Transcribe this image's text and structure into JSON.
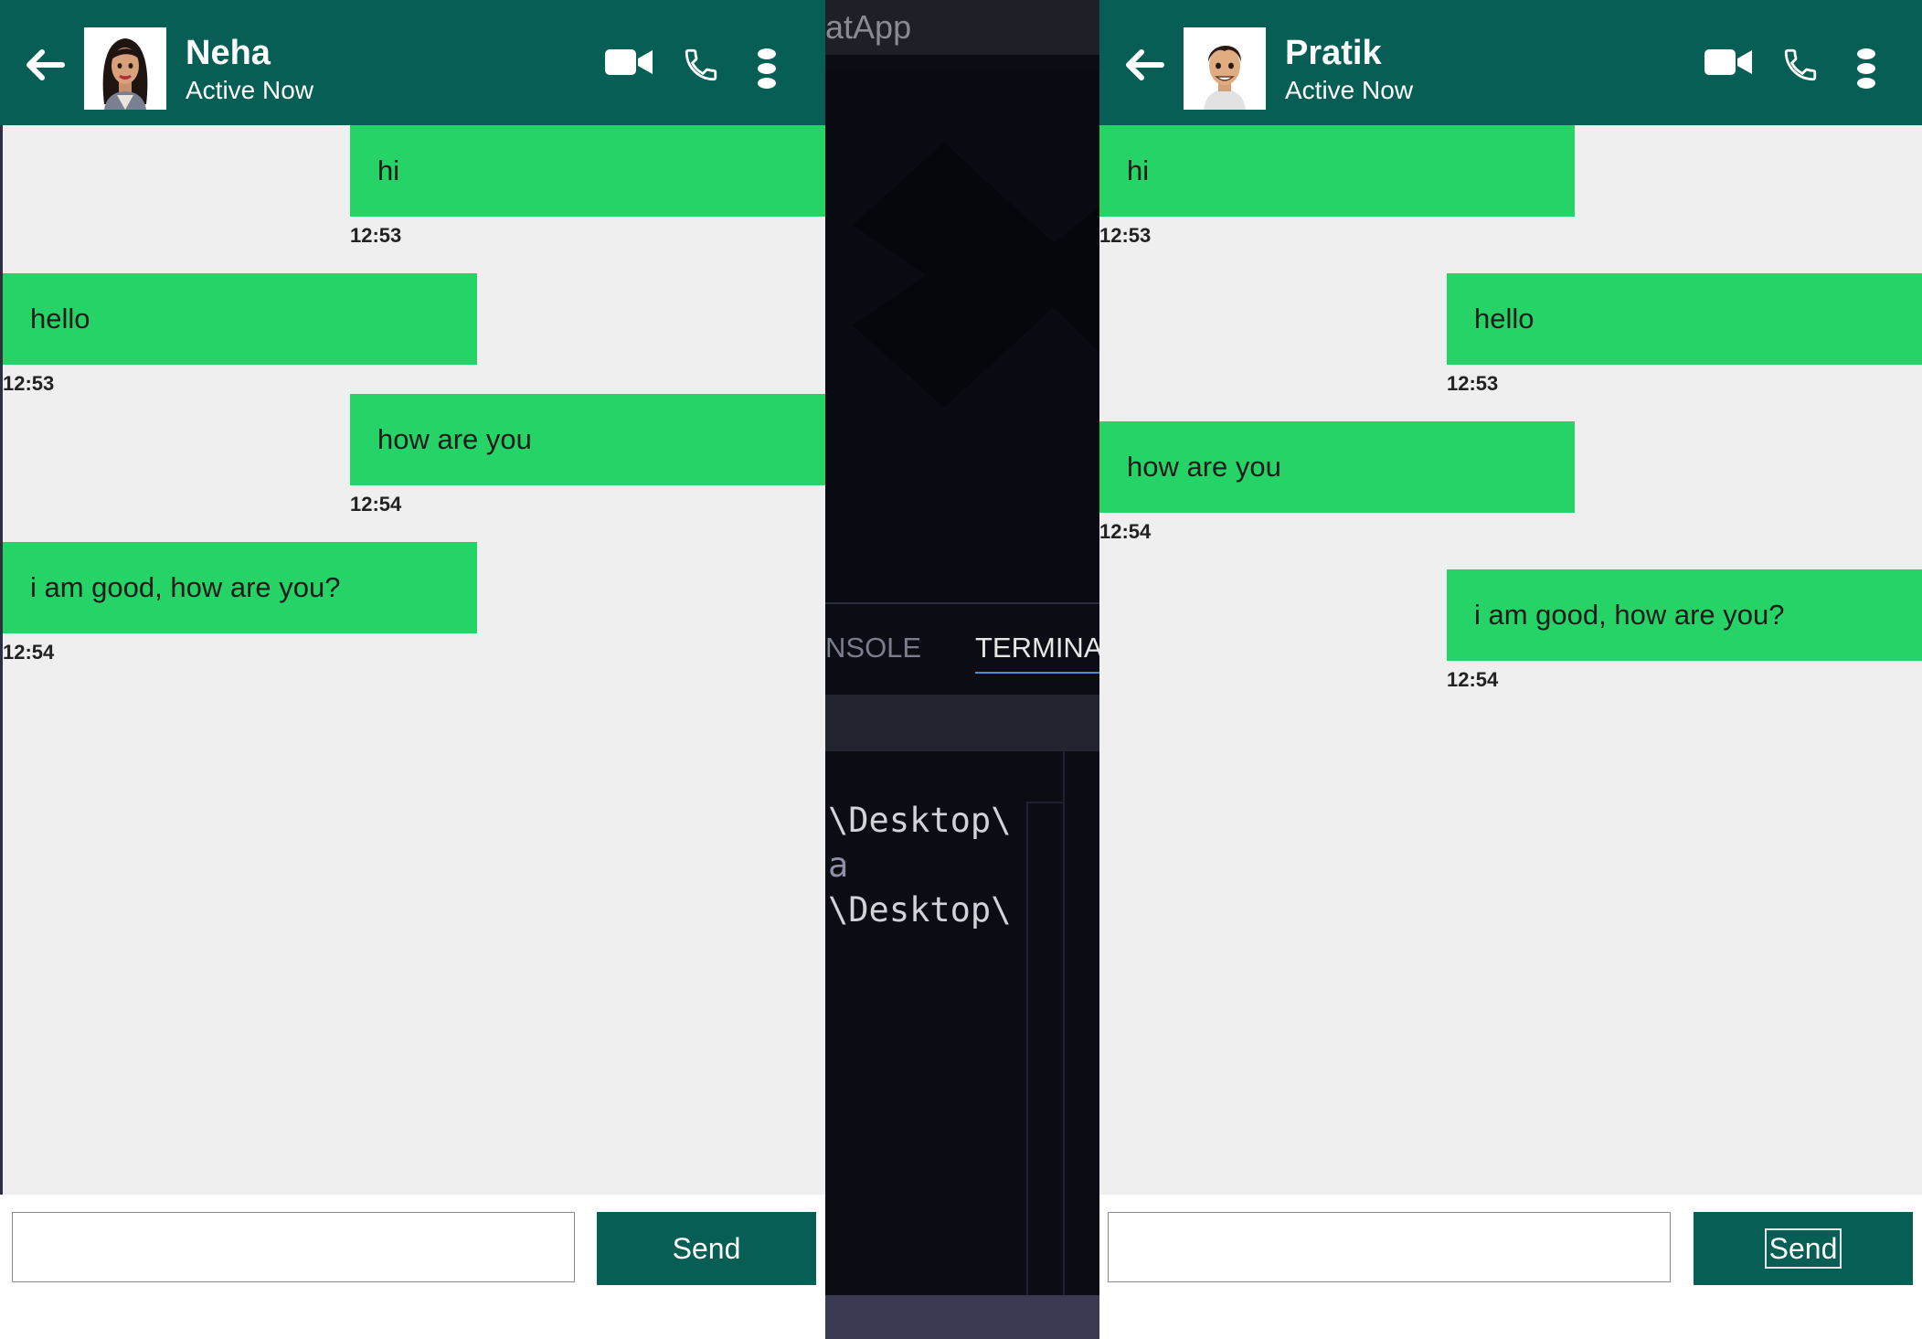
{
  "ide": {
    "title_fragment": "natApp",
    "tabs": [
      {
        "label": "NSOLE"
      },
      {
        "label": "TERMINAL"
      }
    ],
    "terminal_lines": [
      "\\Desktop\\",
      "a",
      "\\Desktop\\"
    ]
  },
  "panes": [
    {
      "contact": {
        "name": "Neha",
        "status": "Active Now",
        "avatar": "girl-avatar"
      },
      "messages": [
        {
          "text": "hi",
          "time": "12:53",
          "side": "right"
        },
        {
          "text": "hello",
          "time": "12:53",
          "side": "left"
        },
        {
          "text": "how are you",
          "time": "12:54",
          "side": "right"
        },
        {
          "text": "i am good, how are you?",
          "time": "12:54",
          "side": "left"
        }
      ],
      "input": {
        "value": "",
        "placeholder": ""
      },
      "send_label": "Send"
    },
    {
      "contact": {
        "name": "Pratik",
        "status": "Active Now",
        "avatar": "boy-avatar"
      },
      "messages": [
        {
          "text": "hi",
          "time": "12:53",
          "side": "left"
        },
        {
          "text": "hello",
          "time": "12:53",
          "side": "right"
        },
        {
          "text": "how are you",
          "time": "12:54",
          "side": "left"
        },
        {
          "text": "i am good, how are you?",
          "time": "12:54",
          "side": "right"
        }
      ],
      "input": {
        "value": "",
        "placeholder": ""
      },
      "send_label": "Send"
    }
  ],
  "icons": {
    "back": "arrow-left-icon",
    "video": "video-camera-icon",
    "call": "phone-icon",
    "menu": "more-vertical-icon"
  },
  "colors": {
    "header": "#075e54",
    "bubble": "#25d366",
    "chat_background": "#efefef",
    "send_button": "#075e54"
  }
}
